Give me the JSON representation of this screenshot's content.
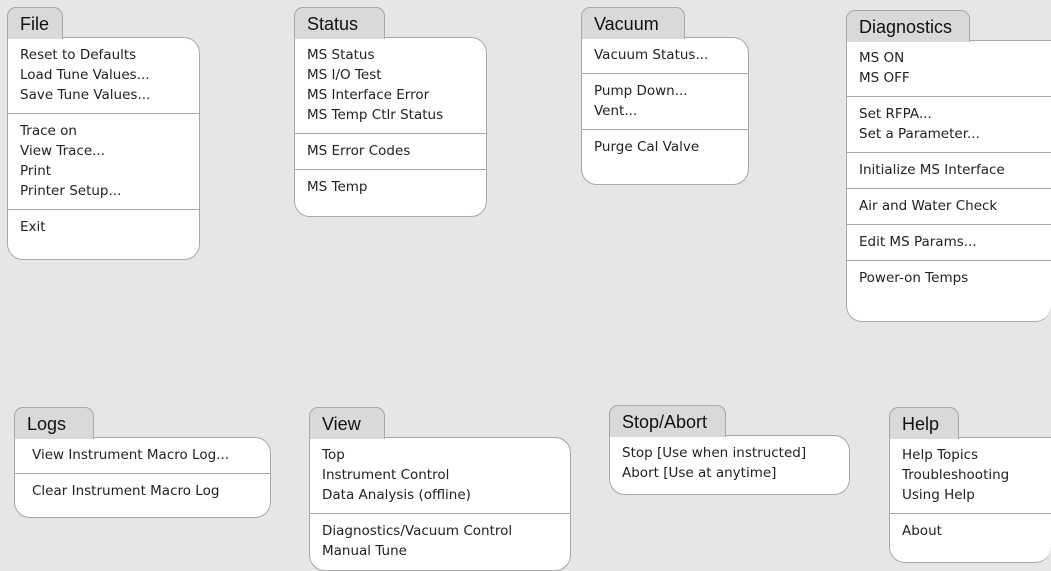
{
  "menus": {
    "file": {
      "title": "File",
      "groups": [
        [
          "Reset to Defaults",
          "Load Tune Values...",
          "Save Tune Values..."
        ],
        [
          "Trace on",
          "View Trace...",
          "Print",
          "Printer Setup..."
        ],
        [
          "Exit"
        ]
      ]
    },
    "status": {
      "title": "Status",
      "groups": [
        [
          "MS Status",
          "MS I/O Test",
          "MS Interface Error",
          "MS Temp Ctlr Status"
        ],
        [
          "MS Error Codes"
        ],
        [
          "MS Temp"
        ]
      ]
    },
    "vacuum": {
      "title": "Vacuum",
      "groups": [
        [
          "Vacuum Status..."
        ],
        [
          "Pump Down...",
          "Vent..."
        ],
        [
          "Purge Cal Valve"
        ]
      ]
    },
    "diagnostics": {
      "title": "Diagnostics",
      "groups": [
        [
          "MS ON",
          "MS OFF"
        ],
        [
          "Set RFPA...",
          "Set a Parameter..."
        ],
        [
          "Initialize MS Interface"
        ],
        [
          "Air and Water Check"
        ],
        [
          "Edit MS Params..."
        ],
        [
          "Power-on Temps"
        ]
      ]
    },
    "logs": {
      "title": "Logs",
      "groups": [
        [
          "View Instrument Macro Log..."
        ],
        [
          "Clear Instrument Macro Log"
        ]
      ]
    },
    "view": {
      "title": "View",
      "groups": [
        [
          "Top",
          "Instrument Control",
          "Data Analysis (offline)"
        ],
        [
          "Diagnostics/Vacuum Control",
          "Manual Tune"
        ]
      ]
    },
    "stop_abort": {
      "title": "Stop/Abort",
      "groups": [
        [
          "Stop [Use when instructed]",
          "Abort [Use at anytime]"
        ]
      ]
    },
    "help": {
      "title": "Help",
      "groups": [
        [
          "Help Topics",
          "Troubleshooting",
          "Using Help"
        ],
        [
          "About"
        ]
      ]
    }
  }
}
